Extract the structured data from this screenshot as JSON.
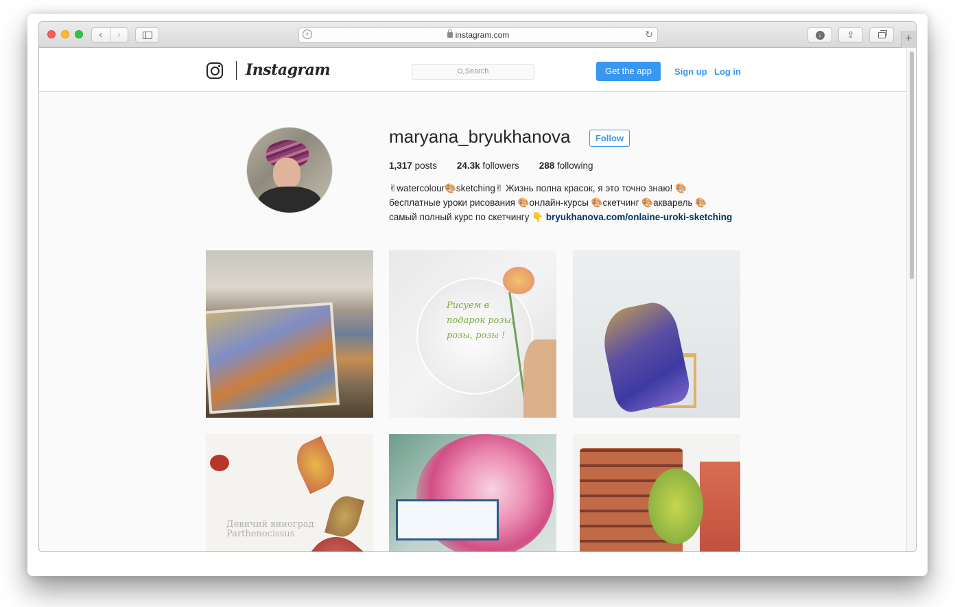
{
  "browser": {
    "url": "instagram.com",
    "back_glyph": "‹",
    "forward_glyph": "›",
    "new_tab_glyph": "+",
    "reload_glyph": "↻",
    "add_glyph": "+",
    "download_glyph": "↓",
    "share_glyph": "⇪"
  },
  "header": {
    "wordmark": "Instagram",
    "search_placeholder": "Search",
    "get_app_label": "Get the app",
    "signup_label": "Sign up",
    "separator": "·",
    "login_label": "Log in"
  },
  "profile": {
    "username": "maryana_bryukhanova",
    "follow_label": "Follow",
    "posts_count": "1,317",
    "posts_label": "posts",
    "followers_count": "24.3k",
    "followers_label": "followers",
    "following_count": "288",
    "following_label": "following",
    "bio_line1": "✌watercolour🎨sketching✌ Жизнь полна красок, я это точно знаю! 🎨",
    "bio_line2": "бесплатные уроки рисования 🎨онлайн-курсы 🎨скетчинг 🎨акварель 🎨",
    "bio_line3_text": "самый полный курс по скетчингу 👇 ",
    "bio_link": "bryukhanova.com/onlaine-uroki-sketching"
  },
  "posts": {
    "post2_text": "Рисуем в подарок розы, розы, розы !",
    "post4_caption_line1": "Девичий виноград",
    "post4_caption_line2": "Parthenocissus"
  },
  "colors": {
    "accent": "#3897f0",
    "link": "#003569",
    "text": "#262626"
  }
}
